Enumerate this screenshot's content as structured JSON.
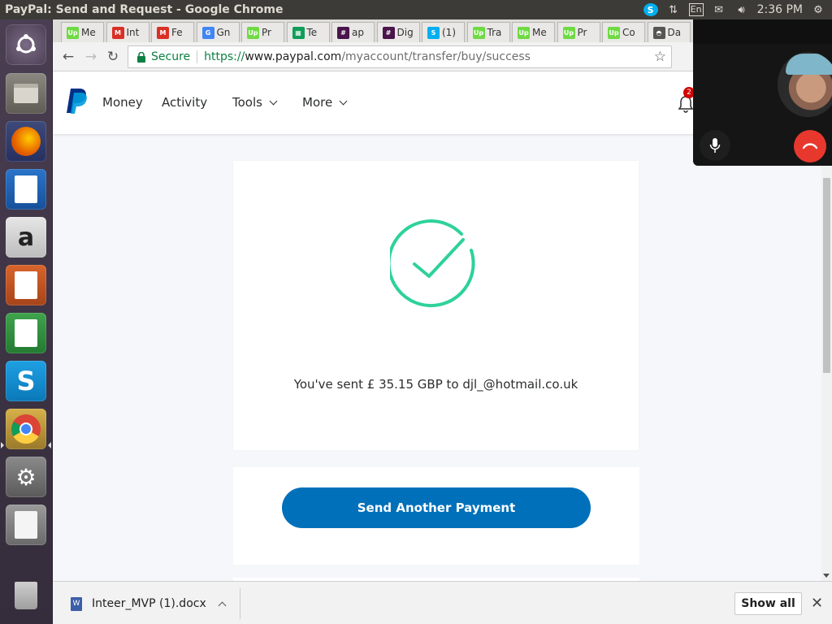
{
  "panel": {
    "window_title": "PayPal: Send and Request - Google Chrome",
    "keyboard": "En",
    "clock": "2:36 PM"
  },
  "launcher": {
    "apps": [
      "ubuntu-dash",
      "files",
      "firefox",
      "libreoffice-writer",
      "amazon",
      "libreoffice-impress",
      "libreoffice-calc",
      "skype",
      "chrome",
      "system-settings",
      "libreoffice",
      "trash"
    ]
  },
  "tabs": [
    {
      "label": "Me",
      "icon": "upwork-icon",
      "color": "#6fda44"
    },
    {
      "label": "Int",
      "icon": "gmail-icon",
      "color": "#d93025"
    },
    {
      "label": "Fe",
      "icon": "gmail-icon",
      "color": "#d93025"
    },
    {
      "label": "Gn",
      "icon": "google-icon",
      "color": "#4285f4"
    },
    {
      "label": "Pr",
      "icon": "upwork-icon",
      "color": "#6fda44"
    },
    {
      "label": "Te",
      "icon": "sheets-icon",
      "color": "#0f9d58"
    },
    {
      "label": "ap",
      "icon": "slack-icon",
      "color": "#4a154b"
    },
    {
      "label": "Dig",
      "icon": "slack-icon",
      "color": "#4a154b"
    },
    {
      "label": "(1)",
      "icon": "skype-icon",
      "color": "#00aff0"
    },
    {
      "label": "Tra",
      "icon": "upwork-icon",
      "color": "#6fda44"
    },
    {
      "label": "Me",
      "icon": "upwork-icon",
      "color": "#6fda44"
    },
    {
      "label": "Pr",
      "icon": "upwork-icon",
      "color": "#6fda44"
    },
    {
      "label": "Co",
      "icon": "upwork-icon",
      "color": "#6fda44"
    },
    {
      "label": "Da",
      "icon": "incognito-icon",
      "color": "#555555"
    }
  ],
  "address_bar": {
    "secure_label": "Secure",
    "scheme": "https://",
    "host": "www.paypal.com",
    "path": "/myaccount/transfer/buy/success"
  },
  "paypal_nav": {
    "money": "Money",
    "activity": "Activity",
    "tools": "Tools",
    "more": "More",
    "notification_count": "2"
  },
  "confirmation": {
    "message": "You've sent £ 35.15 GBP to djl_@hotmail.co.uk",
    "send_another_label": "Send Another Payment"
  },
  "downloads": {
    "file_name": "Inteer_MVP (1).docx",
    "show_all_label": "Show all"
  },
  "colors": {
    "paypal_blue": "#0070ba",
    "success_green": "#2dd299",
    "secure_green": "#0b8043"
  }
}
